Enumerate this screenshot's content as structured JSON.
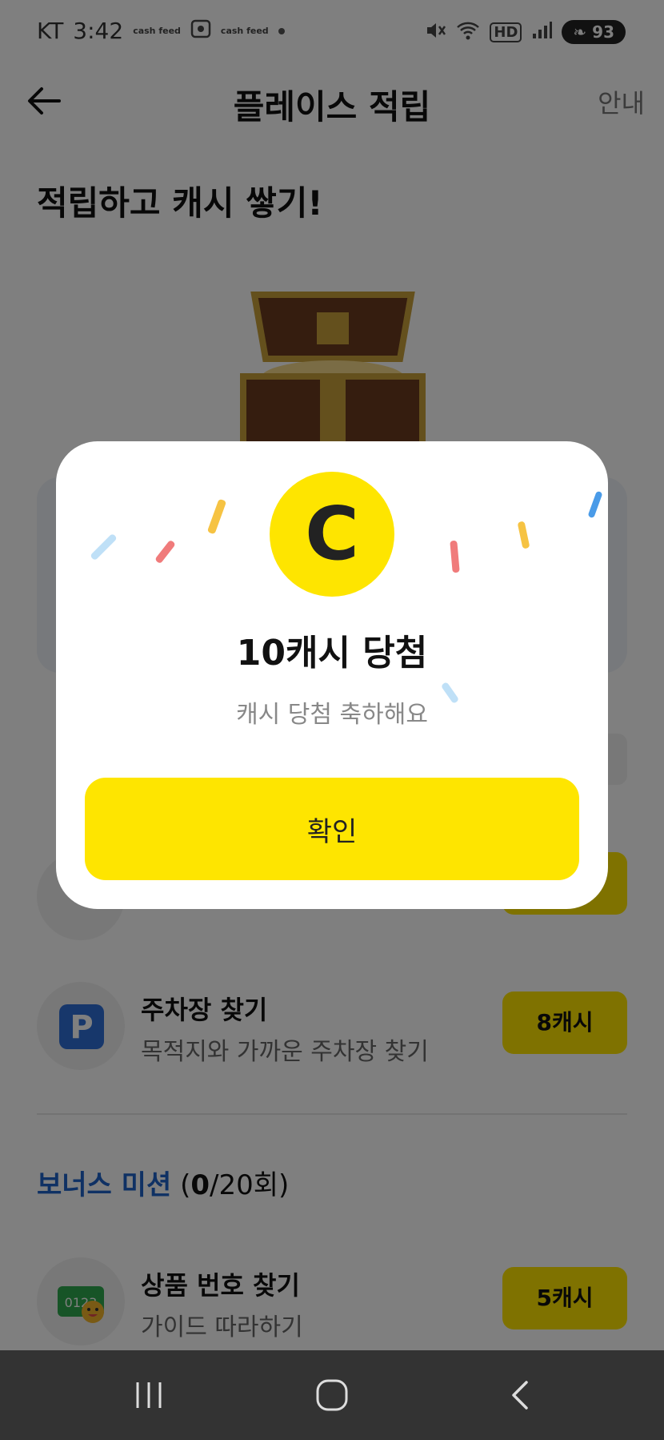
{
  "status_bar": {
    "carrier": "KT",
    "time": "3:42",
    "app_badge_1": "cash feed",
    "app_badge_2": "cash feed",
    "network": "HD",
    "battery": "93"
  },
  "header": {
    "title": "플레이스 적립",
    "guide_label": "안내"
  },
  "headline": "적립하고 캐시 쌓기!",
  "missions": [
    {
      "title": "주차장 찾기",
      "subtitle": "목적지와 가까운 주차장 찾기",
      "reward": "8캐시",
      "icon": "parking-icon"
    },
    {
      "title": "상품 번호 찾기",
      "subtitle": "가이드 따라하기",
      "reward": "5캐시",
      "icon": "product-number-icon"
    }
  ],
  "bonus": {
    "label": "보너스 미션",
    "count_open": "(",
    "count_current": "0",
    "count_rest": "/20회)"
  },
  "modal": {
    "coin_letter": "C",
    "title": "10캐시 당첨",
    "subtitle": "캐시 당첨 축하해요",
    "confirm_label": "확인"
  },
  "colors": {
    "accent_yellow": "#FEE500",
    "link_blue": "#1F63C9",
    "dim_overlay": "rgba(0,0,0,0.5)",
    "navbar": "#333333"
  }
}
